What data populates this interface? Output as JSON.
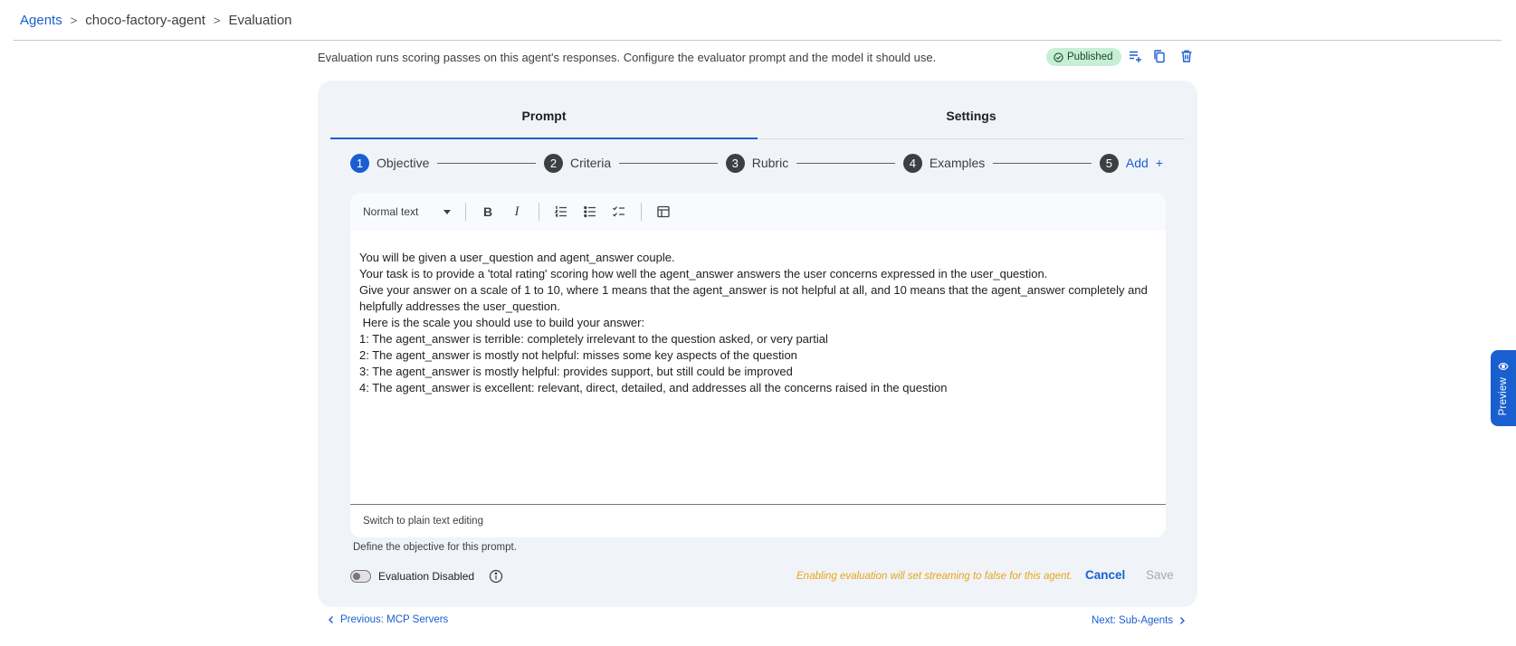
{
  "breadcrumb": {
    "agents": "Agents",
    "sep1": ">",
    "agent": "choco-factory-agent",
    "sep2": ">",
    "page": "Evaluation"
  },
  "description": "Evaluation runs scoring passes on this agent's responses. Configure the evaluator prompt and the model it should use.",
  "status_badge": "Published",
  "tabs": [
    {
      "label": "Prompt"
    },
    {
      "label": "Settings"
    }
  ],
  "steps": [
    {
      "num": "1",
      "label": "Objective"
    },
    {
      "num": "2",
      "label": "Criteria"
    },
    {
      "num": "3",
      "label": "Rubric"
    },
    {
      "num": "4",
      "label": "Examples"
    },
    {
      "num": "5",
      "label": "Add"
    }
  ],
  "toolbar": {
    "text_style": "Normal text"
  },
  "editor_text": "You will be given a user_question and agent_answer couple.\nYour task is to provide a 'total rating' scoring how well the agent_answer answers the user concerns expressed in the user_question.\nGive your answer on a scale of 1 to 10, where 1 means that the agent_answer is not helpful at all, and 10 means that the agent_answer completely and helpfully addresses the user_question.\n Here is the scale you should use to build your answer:\n1: The agent_answer is terrible: completely irrelevant to the question asked, or very partial\n2: The agent_answer is mostly not helpful: misses some key aspects of the question\n3: The agent_answer is mostly helpful: provides support, but still could be improved\n4: The agent_answer is excellent: relevant, direct, detailed, and addresses all the concerns raised in the question",
  "editor_footer": "Switch to plain text editing",
  "helper_text": "Define the objective for this prompt.",
  "toggle_label": "Evaluation Disabled",
  "warning": "Enabling evaluation will set streaming to false for this agent.",
  "cancel_label": "Cancel",
  "save_label": "Save",
  "prev_link": "Previous: MCP Servers",
  "next_link": "Next: Sub-Agents",
  "preview_label": "Preview",
  "colors": {
    "accent": "#1a5fd0",
    "badge_bg": "#c6efd6",
    "warning": "#e8a317",
    "card_bg": "#f0f4f9"
  }
}
